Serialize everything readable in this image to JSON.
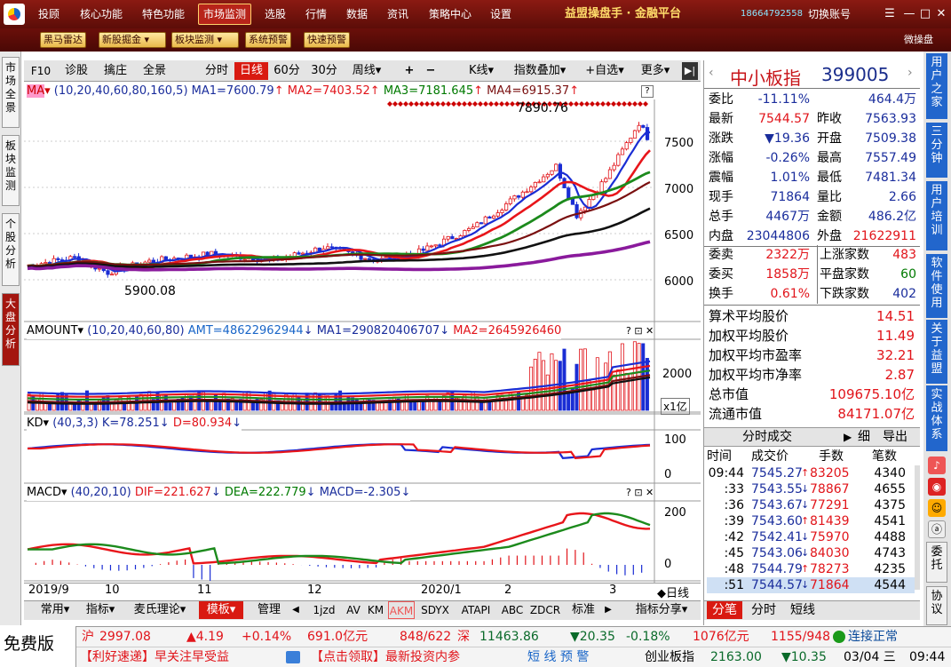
{
  "top_menu": {
    "items": [
      "投顾",
      "核心功能",
      "特色功能",
      "市场监测",
      "选股",
      "行情",
      "数据",
      "资讯",
      "策略中心",
      "设置"
    ],
    "active": "市场监测",
    "brand": "益盟操盘手 · 金融平台",
    "phone": "18664792558",
    "switch_account": "切换账号"
  },
  "toolbar": {
    "buttons": [
      "黑马雷达",
      "新股掘金",
      "板块监测",
      "系统预警",
      "快速预警"
    ],
    "weicaopan": "微操盘"
  },
  "left_tabs": [
    "市场全景",
    "板块监测",
    "个股分析",
    "大盘分析"
  ],
  "chart_toolbar": {
    "f10": "F10",
    "items": [
      "诊股",
      "擒庄",
      "全景",
      "分时",
      "日线",
      "60分",
      "30分",
      "周线",
      "+",
      "−",
      "K线",
      "指数叠加",
      "自选",
      "更多"
    ],
    "active": "日线"
  },
  "main_panel": {
    "header_prefix": "MA",
    "params": "(10,20,40,60,80,160,5)",
    "ma1": "MA1=7600.79",
    "ma2": "MA2=7403.52",
    "ma3": "MA3=7181.645",
    "ma4": "MA4=6915.37",
    "high_label": "7890.76",
    "low_label": "5900.08",
    "y_ticks": [
      "7500",
      "7000",
      "6500",
      "6000"
    ]
  },
  "amount_panel": {
    "header": "AMOUNT",
    "params": "(10,20,40,60,80)",
    "amt": "AMT=48622962944",
    "ma1": "MA1=290820406707",
    "ma2": "MA2=2645926460",
    "y_ticks": [
      "2000"
    ],
    "unit": "x1亿"
  },
  "kd_panel": {
    "header": "KD",
    "params": "(40,3,3)",
    "k": "K=78.251",
    "d": "D=80.934",
    "y_ticks": [
      "100",
      "0"
    ]
  },
  "macd_panel": {
    "header": "MACD",
    "params": "(40,20,10)",
    "dif": "DIF=221.627",
    "dea": "DEA=222.779",
    "macd": "MACD=-2.305",
    "y_ticks": [
      "200",
      "0"
    ]
  },
  "x_axis": {
    "labels": [
      "2019/9",
      "10",
      "11",
      "12",
      "2020/1",
      "2",
      "3"
    ],
    "period": "日线"
  },
  "bottom_tabs": [
    "常用",
    "指标",
    "麦氏理论",
    "模板",
    "管理",
    "1jzd",
    "AV",
    "KM",
    "AKM",
    "SDYX",
    "ATAPI",
    "ABC",
    "ZDCR",
    "标准",
    "指标分享"
  ],
  "quote": {
    "name": "中小板指",
    "code": "399005",
    "rows": [
      {
        "l1": "委比",
        "v1": "-11.11%",
        "l2": "",
        "v2": "464.4万"
      },
      {
        "l1": "最新",
        "v1": "7544.57",
        "l2": "昨收",
        "v2": "7563.93"
      },
      {
        "l1": "涨跌",
        "v1": "▼19.36",
        "l2": "开盘",
        "v2": "7509.38"
      },
      {
        "l1": "涨幅",
        "v1": "-0.26%",
        "l2": "最高",
        "v2": "7557.49"
      },
      {
        "l1": "震幅",
        "v1": "1.01%",
        "l2": "最低",
        "v2": "7481.34"
      },
      {
        "l1": "现手",
        "v1": "71864",
        "l2": "量比",
        "v2": "2.66"
      },
      {
        "l1": "总手",
        "v1": "4467万",
        "l2": "金额",
        "v2": "486.2亿"
      },
      {
        "l1": "内盘",
        "v1": "23044806",
        "l2": "外盘",
        "v2": "21622911"
      }
    ],
    "rows2": [
      {
        "l1": "委卖",
        "v1": "2322万",
        "l2": "上涨家数",
        "v2": "483"
      },
      {
        "l1": "委买",
        "v1": "1858万",
        "l2": "平盘家数",
        "v2": "60"
      },
      {
        "l1": "换手",
        "v1": "0.61%",
        "l2": "下跌家数",
        "v2": "402"
      }
    ],
    "stats": [
      {
        "l": "算术平均股价",
        "v": "14.51"
      },
      {
        "l": "加权平均股价",
        "v": "11.49"
      },
      {
        "l": "加权平均市盈率",
        "v": "32.21"
      },
      {
        "l": "加权平均市净率",
        "v": "2.87"
      },
      {
        "l": "总市值",
        "v": "109675.10亿"
      },
      {
        "l": "流通市值",
        "v": "84171.07亿"
      }
    ]
  },
  "ticks": {
    "title": "分时成交",
    "detail": "细",
    "export": "导出",
    "headers": [
      "时间",
      "成交价",
      "手数",
      "笔数"
    ],
    "rows": [
      [
        "09:44",
        "7545.27",
        "83205",
        "4340"
      ],
      [
        ":33",
        "7543.55",
        "78867",
        "4655"
      ],
      [
        ":36",
        "7543.67",
        "77291",
        "4375"
      ],
      [
        ":39",
        "7543.60",
        "81439",
        "4541"
      ],
      [
        ":42",
        "7542.41",
        "75970",
        "4488"
      ],
      [
        ":45",
        "7543.06",
        "84030",
        "4743"
      ],
      [
        ":48",
        "7544.79",
        "78273",
        "4235"
      ],
      [
        ":51",
        "7544.57",
        "71864",
        "4544"
      ]
    ],
    "bottom_tabs": [
      "分笔",
      "分时",
      "短线"
    ]
  },
  "right_tabs": [
    "用户之家",
    "三分钟",
    "用户培训",
    "软件使用",
    "关于益盟",
    "实战体系",
    "委托",
    "协议"
  ],
  "status": {
    "free": "免费版",
    "sh": {
      "label": "沪",
      "price": "2997.08",
      "chg": "▲4.19",
      "pct": "+0.14%",
      "amt": "691.0亿元",
      "ud": "848/622"
    },
    "sz": {
      "label": "深",
      "price": "11463.86",
      "chg": "▼20.35",
      "pct": "-0.18%",
      "amt": "1076亿元",
      "ud": "1155/948"
    },
    "conn": "连接正常",
    "news1": "【利好速递】早关注早受益",
    "news2": "【点击领取】最新投资内参",
    "warn": "短 线 预 警",
    "cyb": {
      "label": "创业板指",
      "price": "2163.00",
      "chg": "▼10.35"
    },
    "date": "03/04 三",
    "time": "09:44"
  },
  "colors": {
    "ma1": "#1a2dd4",
    "ma2": "#e8151a",
    "ma3": "#1c8a1c",
    "ma4": "#7a1010",
    "ma5": "#111111",
    "ma6": "#8a1a9c",
    "up": "#e1141a",
    "down": "#1a2dd4"
  }
}
